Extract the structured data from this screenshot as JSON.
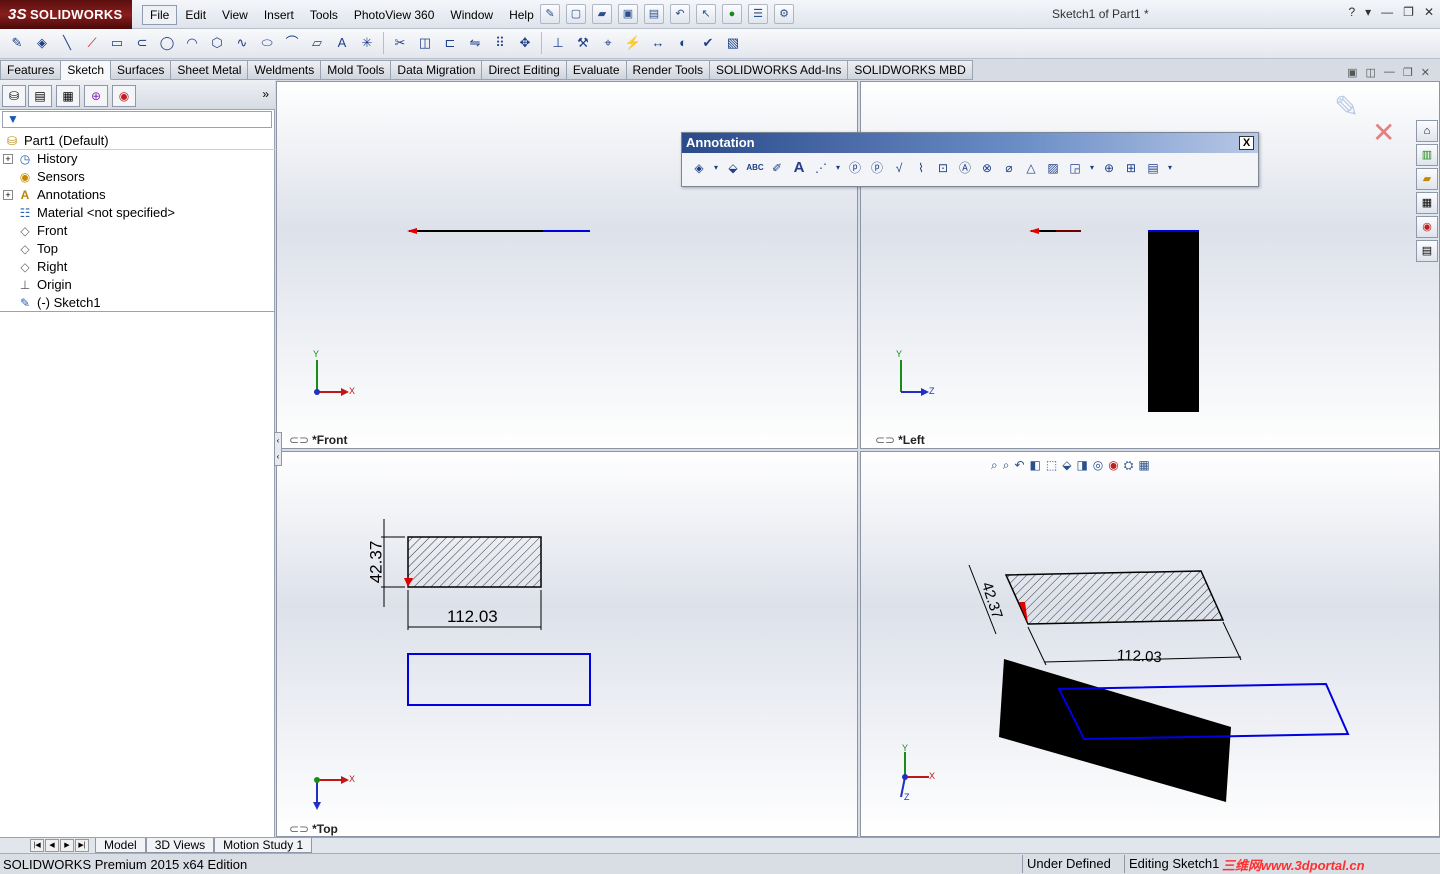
{
  "app": {
    "brand": "SOLIDWORKS",
    "brand_prefix": "3S",
    "document_title": "Sketch1 of Part1 *",
    "help": "?"
  },
  "menu": [
    "File",
    "Edit",
    "View",
    "Insert",
    "Tools",
    "PhotoView 360",
    "Window",
    "Help"
  ],
  "command_tabs": [
    "Features",
    "Sketch",
    "Surfaces",
    "Sheet Metal",
    "Weldments",
    "Mold Tools",
    "Data Migration",
    "Direct Editing",
    "Evaluate",
    "Render Tools",
    "SOLIDWORKS Add-Ins",
    "SOLIDWORKS MBD"
  ],
  "active_tab": "Sketch",
  "feature_tree": {
    "root": "Part1  (Default)",
    "items": [
      {
        "label": "History",
        "expandable": true,
        "icon": "history-icon"
      },
      {
        "label": "Sensors",
        "expandable": false,
        "icon": "sensors-icon"
      },
      {
        "label": "Annotations",
        "expandable": true,
        "icon": "annotations-icon"
      },
      {
        "label": "Material <not specified>",
        "expandable": false,
        "icon": "material-icon"
      },
      {
        "label": "Front",
        "expandable": false,
        "icon": "plane-icon"
      },
      {
        "label": "Top",
        "expandable": false,
        "icon": "plane-icon"
      },
      {
        "label": "Right",
        "expandable": false,
        "icon": "plane-icon"
      },
      {
        "label": "Origin",
        "expandable": false,
        "icon": "origin-icon"
      },
      {
        "label": "(-) Sketch1",
        "expandable": false,
        "icon": "sketch-icon"
      }
    ]
  },
  "viewports": {
    "front": "*Front",
    "left": "*Left",
    "top": "*Top"
  },
  "axes": {
    "x": "X",
    "y": "Y",
    "z": "Z"
  },
  "dimensions": {
    "width": "112.03",
    "height": "42.37"
  },
  "annotation_toolbar": {
    "title": "Annotation",
    "close": "X",
    "spell_label": "ABC"
  },
  "bottom_tabs": [
    "Model",
    "3D Views",
    "Motion Study 1"
  ],
  "status": {
    "edition": "SOLIDWORKS Premium 2015 x64 Edition",
    "state": "Under Defined",
    "editing": "Editing Sketch1",
    "watermark": "三维网www.3dportal.cn"
  },
  "colors": {
    "sketch_blue": "#0000e0",
    "arrow_red": "#e00000",
    "brand_red": "#8a1d1d"
  }
}
